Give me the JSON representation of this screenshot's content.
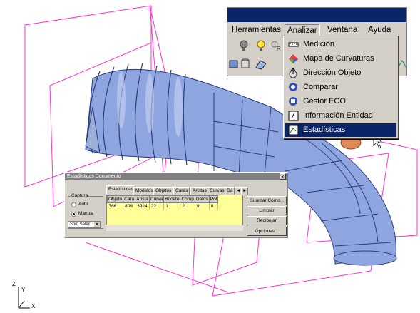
{
  "menubar": {
    "items": [
      {
        "label": "Herramientas",
        "underline": "H"
      },
      {
        "label": "Analizar",
        "underline": "A",
        "active": true
      },
      {
        "label": "Ventana",
        "underline": "V"
      },
      {
        "label": "Ayuda",
        "underline": "y"
      }
    ]
  },
  "dropdown": {
    "items": [
      {
        "label": "Medición",
        "icon": "ruler-icon"
      },
      {
        "label": "Mapa de Curvaturas",
        "icon": "curvature-map-icon"
      },
      {
        "label": "Dirección Objeto",
        "icon": "direction-icon"
      },
      {
        "label": "Comparar",
        "icon": "compare-icon"
      },
      {
        "label": "Gestor ECO",
        "icon": "eco-manager-icon"
      },
      {
        "label": "Información Entidad",
        "icon": "entity-info-icon"
      },
      {
        "label": "Estadísticas",
        "icon": "statistics-icon",
        "selected": true
      }
    ]
  },
  "dialog": {
    "title": "Estadísticas Documento",
    "close": "x",
    "tabs": [
      "Estadísticas",
      "Modelos",
      "Objetos",
      "Caras",
      "Aristas",
      "Curvas",
      "Da"
    ],
    "tab_scroll_left": "◄",
    "tab_scroll_right": "►",
    "capture": {
      "legend": "Captura",
      "auto": "Auto",
      "manual": "Manual",
      "selected": "Manual",
      "select_value": "Sólo Selec"
    },
    "table": {
      "headers": [
        "Objeto",
        "Cara",
        "Arista",
        "Curva",
        "Boceto",
        "Comp",
        "Datos",
        "Pol"
      ],
      "rows": [
        [
          "766",
          "808",
          "3924",
          "22",
          "1",
          "2",
          "9",
          "0"
        ]
      ]
    },
    "buttons": {
      "save": "Guardar Como...",
      "clear": "Limpiar",
      "redraw": "Redibujar",
      "options": "Opciones..."
    }
  },
  "axes": {
    "z": "Z",
    "y": "Y",
    "x": "X"
  },
  "colors": {
    "titlebar": "#0a246a",
    "selection": "#0a246a",
    "model": "#8fa5e0",
    "planes": "#ff33cc",
    "grid_bg": "#ffff99"
  }
}
